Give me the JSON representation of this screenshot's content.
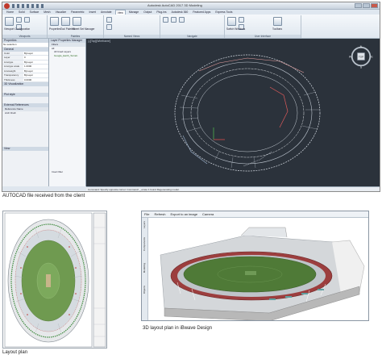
{
  "autocad": {
    "title": "Autodesk AutoCAD 2017  3D Modeling",
    "tabs": [
      "Home",
      "Solid",
      "Surface",
      "Mesh",
      "Visualize",
      "Parametric",
      "Insert",
      "Annotate",
      "View",
      "Manage",
      "Output",
      "Plug-ins",
      "Autodesk 360",
      "Featured Apps",
      "Express Tools"
    ],
    "active_tab": "View",
    "ribbon_groups": [
      "Viewports",
      "Palettes",
      "Named Views",
      "Navigate",
      "User Interface"
    ],
    "ribbon_buttons": [
      "Viewport Configuration",
      "Properties",
      "Tool Palettes",
      "Sheet Set Manager",
      "Switch Windows",
      "Toolbars"
    ],
    "compass": {
      "n": "N",
      "s": "S",
      "w": "W",
      "e": "E",
      "center": "TOP",
      "wcs": "WCS"
    },
    "viewport_label": "[-][Top][Wireframe]",
    "properties": {
      "title": "Properties",
      "selection": "No selection",
      "section_general": "General",
      "rows": [
        {
          "k": "Color",
          "v": "ByLayer"
        },
        {
          "k": "Layer",
          "v": "0"
        },
        {
          "k": "Linetype",
          "v": "ByLayer"
        },
        {
          "k": "Linetype scale",
          "v": "1.0000"
        },
        {
          "k": "Lineweight",
          "v": "ByLayer"
        },
        {
          "k": "Transparency",
          "v": "ByLayer"
        },
        {
          "k": "Thickness",
          "v": "0.0000"
        }
      ],
      "section_3d": "3D Visualization",
      "section_plot": "Plot style",
      "section_view": "View"
    },
    "xref": {
      "title": "External References",
      "items": [
        "Reference Name",
        "Arch Draft"
      ]
    },
    "layers": {
      "title": "Layer Properties Manager",
      "filters_label": "Filters",
      "items": [
        "All",
        "All Used Layers"
      ],
      "file_item": "Google_Earth_Terrain",
      "invert_label": "Invert filter"
    },
    "command_line": "Command:  Specify opposite corner:  Command:  _.erase 1 found   Regenerating model.",
    "layout_tabs": [
      "Model",
      "Layout1",
      "Layout2"
    ]
  },
  "captions": {
    "autocad": "AUTOCAD file received from the client",
    "plan": "Layout plan",
    "ib3d": "3D layout plan in iBwave Design"
  },
  "ibwave": {
    "menu": [
      "File",
      "Refresh",
      "Export to an image",
      "Camera"
    ],
    "side_tabs": [
      "Layers",
      "Components",
      "Modeling",
      "Objects"
    ]
  },
  "colors": {
    "acad_bg": "#2b323b",
    "field_green": "#4f7a37",
    "roof_white": "#e7e7e7"
  }
}
